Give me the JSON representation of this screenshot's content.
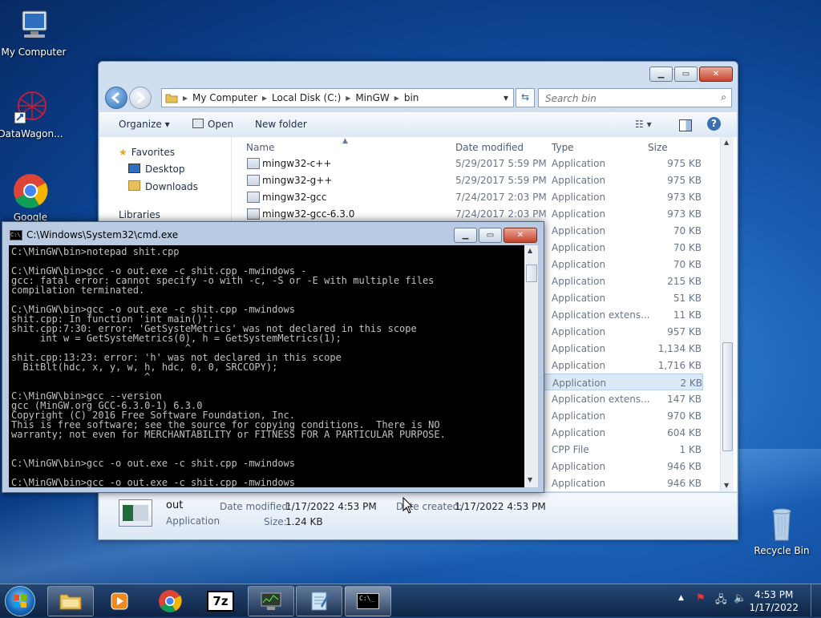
{
  "desktop": {
    "icons": [
      {
        "label": "My Computer"
      },
      {
        "label": "DataWagon..."
      },
      {
        "label": "Google"
      },
      {
        "label": "Recycle Bin"
      }
    ]
  },
  "explorer": {
    "breadcrumb": [
      "My Computer",
      "Local Disk (C:)",
      "MinGW",
      "bin"
    ],
    "search_placeholder": "Search bin",
    "toolbar": {
      "organize": "Organize",
      "open": "Open",
      "new_folder": "New folder"
    },
    "nav": {
      "favorites": "Favorites",
      "desktop": "Desktop",
      "downloads": "Downloads",
      "libraries": "Libraries"
    },
    "columns": {
      "name": "Name",
      "date": "Date modified",
      "type": "Type",
      "size": "Size"
    },
    "rows": [
      {
        "name": "mingw32-c++",
        "date": "5/29/2017 5:59 PM",
        "type": "Application",
        "size": "975 KB"
      },
      {
        "name": "mingw32-g++",
        "date": "5/29/2017 5:59 PM",
        "type": "Application",
        "size": "975 KB"
      },
      {
        "name": "mingw32-gcc",
        "date": "7/24/2017 2:03 PM",
        "type": "Application",
        "size": "973 KB"
      },
      {
        "name": "mingw32-gcc-6.3.0",
        "date": "7/24/2017 2:03 PM",
        "type": "Application",
        "size": "973 KB"
      },
      {
        "name": "",
        "date": "",
        "type": "Application",
        "size": "70 KB"
      },
      {
        "name": "",
        "date": "",
        "type": "Application",
        "size": "70 KB"
      },
      {
        "name": "",
        "date": "",
        "type": "Application",
        "size": "70 KB"
      },
      {
        "name": "",
        "date": "",
        "type": "Application",
        "size": "215 KB"
      },
      {
        "name": "",
        "date": "",
        "type": "Application",
        "size": "51 KB"
      },
      {
        "name": "",
        "date": "",
        "type": "Application extens...",
        "size": "11 KB"
      },
      {
        "name": "",
        "date": "",
        "type": "Application",
        "size": "957 KB"
      },
      {
        "name": "",
        "date": "",
        "type": "Application",
        "size": "1,134 KB"
      },
      {
        "name": "",
        "date": "",
        "type": "Application",
        "size": "1,716 KB"
      },
      {
        "name": "",
        "date": "",
        "type": "Application",
        "size": "2 KB"
      },
      {
        "name": "",
        "date": "",
        "type": "Application extens...",
        "size": "147 KB"
      },
      {
        "name": "",
        "date": "",
        "type": "Application",
        "size": "970 KB"
      },
      {
        "name": "",
        "date": "",
        "type": "Application",
        "size": "604 KB"
      },
      {
        "name": "",
        "date": "",
        "type": "CPP File",
        "size": "1 KB"
      },
      {
        "name": "",
        "date": "",
        "type": "Application",
        "size": "946 KB"
      },
      {
        "name": "",
        "date": "",
        "type": "Application",
        "size": "946 KB"
      }
    ],
    "selected_row": 13,
    "details": {
      "name": "out",
      "type": "Application",
      "modified_label": "Date modified:",
      "modified_value": "1/17/2022 4:53 PM",
      "created_label": "Date created:",
      "created_value": "1/17/2022 4:53 PM",
      "size_label": "Size:",
      "size_value": "1.24 KB"
    }
  },
  "cmd": {
    "title": "C:\\Windows\\System32\\cmd.exe",
    "lines": [
      "C:\\MinGW\\bin>notepad shit.cpp",
      "",
      "C:\\MinGW\\bin>gcc -o out.exe -c shit.cpp -mwindows -",
      "gcc: fatal error: cannot specify -o with -c, -S or -E with multiple files",
      "compilation terminated.",
      "",
      "C:\\MinGW\\bin>gcc -o out.exe -c shit.cpp -mwindows",
      "shit.cpp: In function 'int main()':",
      "shit.cpp:7:30: error: 'GetSysteMetrics' was not declared in this scope",
      "     int w = GetSysteMetrics(0), h = GetSystemMetrics(1);",
      "                              ^",
      "shit.cpp:13:23: error: 'h' was not declared in this scope",
      "  BitBlt(hdc, x, y, w, h, hdc, 0, 0, SRCCOPY);",
      "                       ^",
      "",
      "C:\\MinGW\\bin>gcc --version",
      "gcc (MinGW.org GCC-6.3.0-1) 6.3.0",
      "Copyright (C) 2016 Free Software Foundation, Inc.",
      "This is free software; see the source for copying conditions.  There is NO",
      "warranty; not even for MERCHANTABILITY or FITNESS FOR A PARTICULAR PURPOSE.",
      "",
      "",
      "C:\\MinGW\\bin>gcc -o out.exe -c shit.cpp -mwindows",
      "",
      "C:\\MinGW\\bin>gcc -o out.exe -c shit.cpp -mwindows"
    ]
  },
  "taskbar": {
    "time": "4:53 PM",
    "date": "1/17/2022",
    "apps": [
      "start-orb",
      "explorer",
      "media-player",
      "chrome",
      "7zip",
      "task-manager",
      "notepad",
      "cmd"
    ]
  },
  "colors": {
    "selection": "#dbe9f8",
    "console_bg": "#000000",
    "console_fg": "#c0c0c0"
  }
}
